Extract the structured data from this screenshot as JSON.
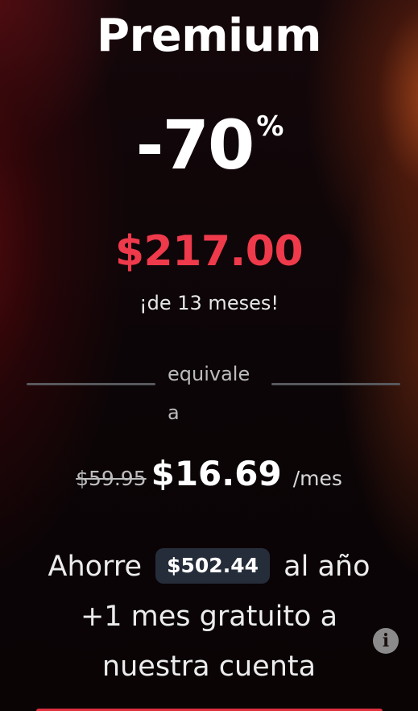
{
  "plan": {
    "title": "Premium",
    "discount_value": "-70",
    "discount_suffix": "%",
    "total_price": "$217.00",
    "duration_note": "¡de 13 meses!"
  },
  "equivalence": {
    "label_line1": "equivale",
    "label_line2": "a"
  },
  "monthly": {
    "old_price": "$59.95",
    "new_price": "$16.69",
    "period": "/mes"
  },
  "savings": {
    "prefix": "Ahorre",
    "amount": "$502.44",
    "suffix": "al año",
    "bonus_line1": "+1 mes gratuito a",
    "bonus_line2": "nuestra cuenta"
  },
  "icons": {
    "info": "info-icon"
  },
  "colors": {
    "accent_red": "#ef3a4b",
    "badge_bg": "#262d3a",
    "background": "#0c0507"
  }
}
